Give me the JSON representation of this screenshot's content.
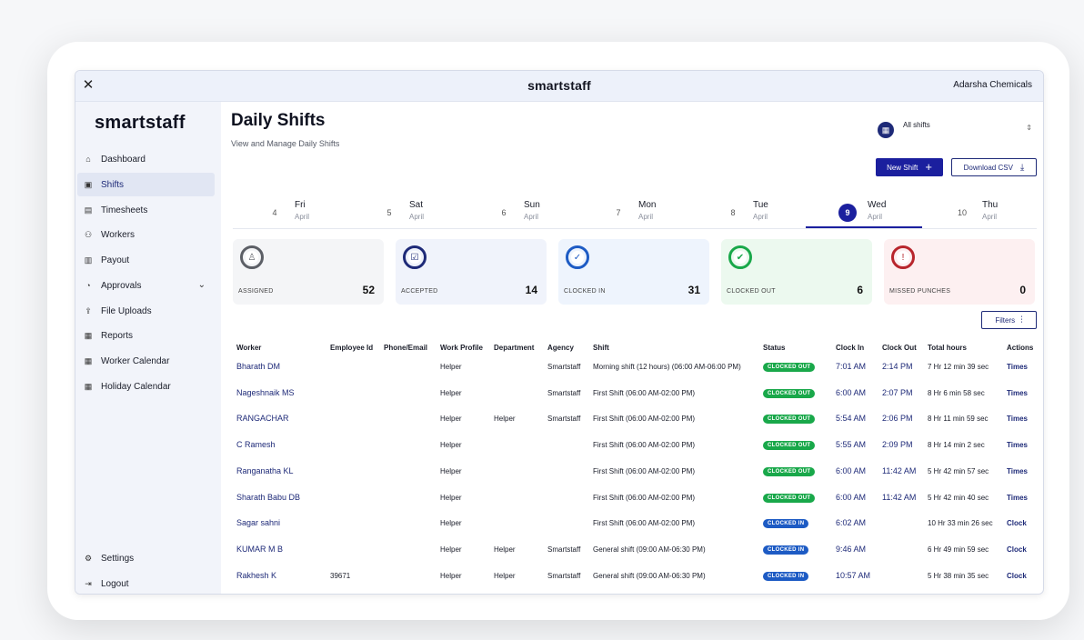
{
  "window": {
    "logo": "smartstaff",
    "company": "Adarsha Chemicals"
  },
  "sidebar": {
    "brand": "smartstaff",
    "items": [
      {
        "label": "Dashboard",
        "icon": "home-icon"
      },
      {
        "label": "Shifts",
        "icon": "shifts-icon",
        "active": true
      },
      {
        "label": "Timesheets",
        "icon": "timesheet-icon"
      },
      {
        "label": "Workers",
        "icon": "users-icon"
      },
      {
        "label": "Payout",
        "icon": "payout-icon"
      },
      {
        "label": "Approvals",
        "icon": "approvals-icon",
        "expandable": true
      },
      {
        "label": "File Uploads",
        "icon": "upload-icon"
      },
      {
        "label": "Reports",
        "icon": "reports-icon"
      },
      {
        "label": "Worker Calendar",
        "icon": "calendar-icon"
      },
      {
        "label": "Holiday Calendar",
        "icon": "calendar-icon"
      }
    ],
    "bottom": [
      {
        "label": "Settings",
        "icon": "gear-icon"
      },
      {
        "label": "Logout",
        "icon": "logout-icon"
      }
    ]
  },
  "header": {
    "title": "Daily Shifts",
    "subtitle": "View and Manage Daily Shifts",
    "shift_filter": "All shifts",
    "new_shift": "New Shift",
    "download_csv": "Download CSV"
  },
  "days": [
    {
      "num": "4",
      "name": "Fri",
      "month": "April"
    },
    {
      "num": "5",
      "name": "Sat",
      "month": "April"
    },
    {
      "num": "6",
      "name": "Sun",
      "month": "April"
    },
    {
      "num": "7",
      "name": "Mon",
      "month": "April"
    },
    {
      "num": "8",
      "name": "Tue",
      "month": "April"
    },
    {
      "num": "9",
      "name": "Wed",
      "month": "April",
      "active": true
    },
    {
      "num": "10",
      "name": "Thu",
      "month": "April"
    }
  ],
  "stats": [
    {
      "label": "ASSIGNED",
      "value": "52",
      "color": "#5c5f66",
      "bg": "#f4f5f7",
      "icon": "user-icon"
    },
    {
      "label": "ACCEPTED",
      "value": "14",
      "color": "#1e2a78",
      "bg": "#f0f3fb",
      "icon": "clipboard-check-icon"
    },
    {
      "label": "CLOCKED IN",
      "value": "31",
      "color": "#1d5bc4",
      "bg": "#eef4fd",
      "icon": "check-icon"
    },
    {
      "label": "CLOCKED OUT",
      "value": "6",
      "color": "#19a84a",
      "bg": "#ecf9ef",
      "icon": "double-check-icon"
    },
    {
      "label": "MISSED PUNCHES",
      "value": "0",
      "color": "#b8262d",
      "bg": "#fdf0f1",
      "icon": "alert-icon"
    }
  ],
  "filters_label": "Filters",
  "table": {
    "columns": [
      "Worker",
      "Employee Id",
      "Phone/Email",
      "Work Profile",
      "Department",
      "Agency",
      "Shift",
      "Status",
      "Clock In",
      "Clock Out",
      "Total hours",
      "Actions"
    ],
    "rows": [
      {
        "worker": "Bharath DM",
        "emp": "",
        "phone": "",
        "profile": "Helper",
        "dept": "",
        "agency": "Smartstaff",
        "shift": "Morning shift (12 hours) (06:00 AM-06:00 PM)",
        "status": "CLOCKED OUT",
        "in": "7:01 AM",
        "out": "2:14 PM",
        "total": "7 Hr 12 min 39 sec",
        "action": "Times"
      },
      {
        "worker": "Nageshnaik MS",
        "emp": "",
        "phone": "",
        "profile": "Helper",
        "dept": "",
        "agency": "Smartstaff",
        "shift": "First Shift (06:00 AM-02:00 PM)",
        "status": "CLOCKED OUT",
        "in": "6:00 AM",
        "out": "2:07 PM",
        "total": "8 Hr 6 min 58 sec",
        "action": "Times"
      },
      {
        "worker": "RANGACHAR",
        "emp": "",
        "phone": "",
        "profile": "Helper",
        "dept": "Helper",
        "agency": "Smartstaff",
        "shift": "First Shift (06:00 AM-02:00 PM)",
        "status": "CLOCKED OUT",
        "in": "5:54 AM",
        "out": "2:06 PM",
        "total": "8 Hr 11 min 59 sec",
        "action": "Times"
      },
      {
        "worker": "C Ramesh",
        "emp": "",
        "phone": "",
        "profile": "Helper",
        "dept": "",
        "agency": "",
        "shift": "First Shift (06:00 AM-02:00 PM)",
        "status": "CLOCKED OUT",
        "in": "5:55 AM",
        "out": "2:09 PM",
        "total": "8 Hr 14 min 2 sec",
        "action": "Times"
      },
      {
        "worker": "Ranganatha KL",
        "emp": "",
        "phone": "",
        "profile": "Helper",
        "dept": "",
        "agency": "",
        "shift": "First Shift (06:00 AM-02:00 PM)",
        "status": "CLOCKED OUT",
        "in": "6:00 AM",
        "out": "11:42 AM",
        "total": "5 Hr 42 min 57 sec",
        "action": "Times"
      },
      {
        "worker": "Sharath Babu DB",
        "emp": "",
        "phone": "",
        "profile": "Helper",
        "dept": "",
        "agency": "",
        "shift": "First Shift (06:00 AM-02:00 PM)",
        "status": "CLOCKED OUT",
        "in": "6:00 AM",
        "out": "11:42 AM",
        "total": "5 Hr 42 min 40 sec",
        "action": "Times"
      },
      {
        "worker": "Sagar sahni",
        "emp": "",
        "phone": "",
        "profile": "Helper",
        "dept": "",
        "agency": "",
        "shift": "First Shift (06:00 AM-02:00 PM)",
        "status": "CLOCKED IN",
        "in": "6:02 AM",
        "out": "",
        "total": "10 Hr 33 min 26 sec",
        "action": "Clock"
      },
      {
        "worker": "KUMAR M B",
        "emp": "",
        "phone": "",
        "profile": "Helper",
        "dept": "Helper",
        "agency": "Smartstaff",
        "shift": "General shift (09:00 AM-06:30 PM)",
        "status": "CLOCKED IN",
        "in": "9:46 AM",
        "out": "",
        "total": "6 Hr 49 min 59 sec",
        "action": "Clock"
      },
      {
        "worker": "Rakhesh K",
        "emp": "39671",
        "phone": "",
        "profile": "Helper",
        "dept": "Helper",
        "agency": "Smartstaff",
        "shift": "General shift (09:00 AM-06:30 PM)",
        "status": "CLOCKED IN",
        "in": "10:57 AM",
        "out": "",
        "total": "5 Hr 38 min 35 sec",
        "action": "Clock"
      }
    ]
  }
}
